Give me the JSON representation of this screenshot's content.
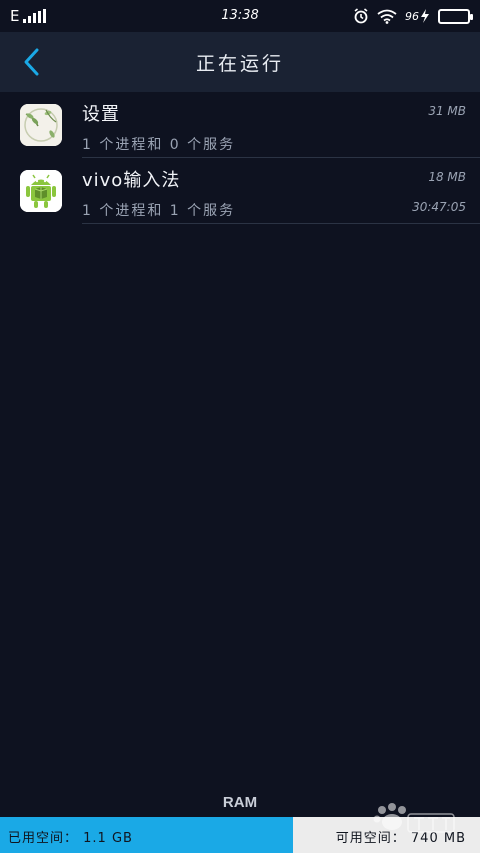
{
  "status_bar": {
    "carrier": "E",
    "time": "13:38",
    "battery_pct": "96",
    "battery_level": 0.96
  },
  "header": {
    "title": "正在运行"
  },
  "processes": [
    {
      "name": "设置",
      "desc": "1 个进程和 0 个服务",
      "memory": "31 MB",
      "time": "",
      "icon": "settings-app-icon"
    },
    {
      "name": "vivo输入法",
      "desc": "1 个进程和 1 个服务",
      "memory": "18 MB",
      "time": "30:47:05",
      "icon": "android-app-icon"
    }
  ],
  "ram": {
    "label": "RAM",
    "used": "已用空间： 1.1 GB",
    "free": "可用空间： 740 MB",
    "used_fraction": 0.61
  },
  "colors": {
    "background": "#0e1220",
    "header": "#1a2233",
    "accent": "#1aa9e6"
  }
}
